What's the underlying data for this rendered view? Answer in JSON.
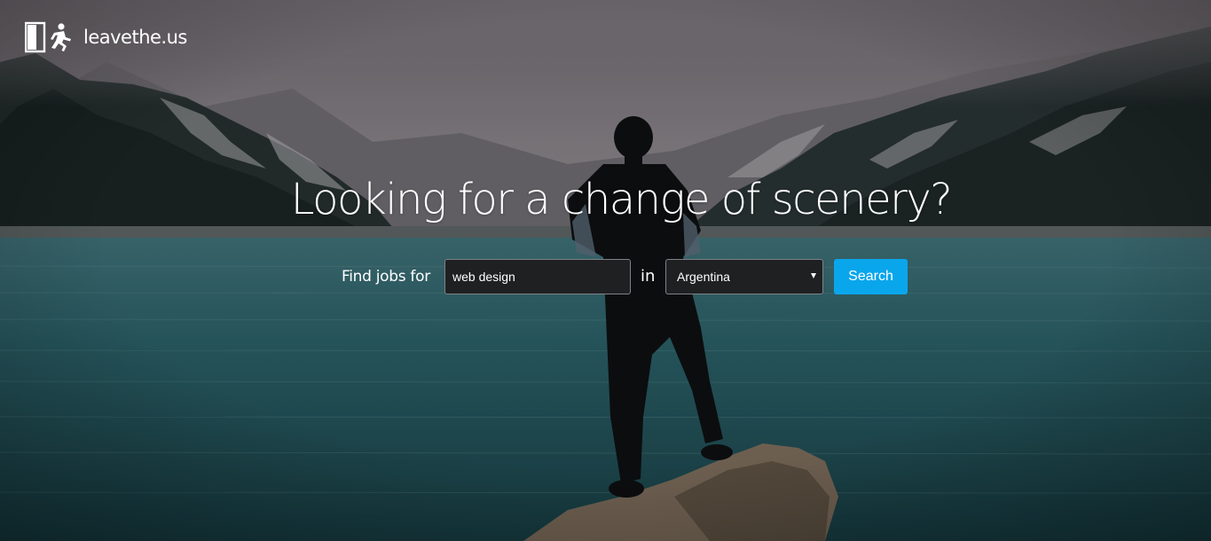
{
  "header": {
    "logo_text": "leavethe.us",
    "logo_icon": "door-exit-runner-icon"
  },
  "hero": {
    "headline": "Looking for a change of scenery?",
    "background": "mountain-lake-person-on-rock-photo"
  },
  "search": {
    "find_label": "Find jobs for",
    "keyword_value": "web design",
    "in_label": "in",
    "country_selected": "Argentina",
    "button_label": "Search"
  },
  "colors": {
    "accent": "#0aa6ec",
    "input_bg": "#1f2022",
    "input_border": "#7e8286",
    "text": "#ffffff"
  }
}
